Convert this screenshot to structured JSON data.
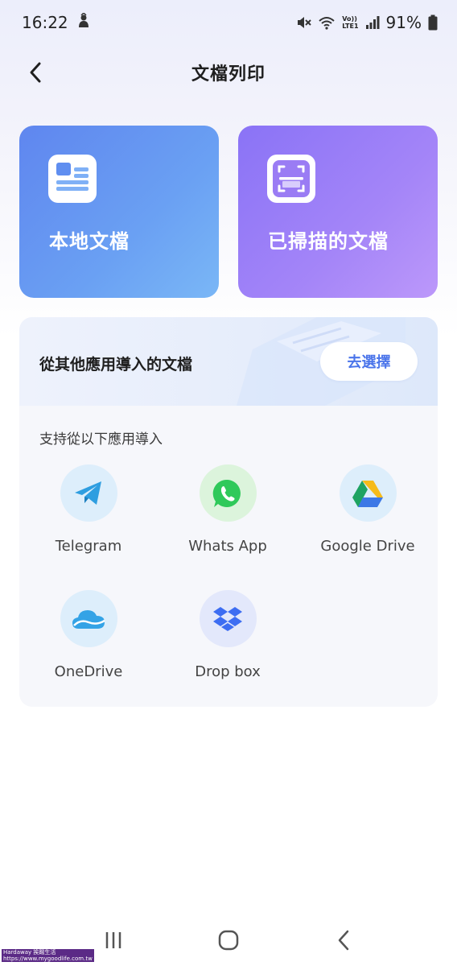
{
  "status_bar": {
    "time": "16:22",
    "battery": "91%",
    "lte_label": "LTE1",
    "volte_label": "Vo))"
  },
  "app_bar": {
    "title": "文檔列印"
  },
  "cards": {
    "local": {
      "label": "本地文檔",
      "icon": "document-icon"
    },
    "scanned": {
      "label": "已掃描的文檔",
      "icon": "scan-icon"
    }
  },
  "import": {
    "title": "從其他應用導入的文檔",
    "choose_button": "去選擇",
    "subtitle": "支持從以下應用導入",
    "apps": [
      {
        "label": "Telegram",
        "icon": "telegram-icon"
      },
      {
        "label": "Whats App",
        "icon": "whatsapp-icon"
      },
      {
        "label": "Google Drive",
        "icon": "google-drive-icon"
      },
      {
        "label": "OneDrive",
        "icon": "onedrive-icon"
      },
      {
        "label": "Drop box",
        "icon": "dropbox-icon"
      }
    ]
  },
  "watermark": {
    "line1": "Hardaway 挨踢生活",
    "line2": "https://www.mygoodlife.com.tw"
  },
  "colors": {
    "accent": "#4a74ea",
    "local_card": "#6aa0f3",
    "scan_card": "#a485f8"
  }
}
